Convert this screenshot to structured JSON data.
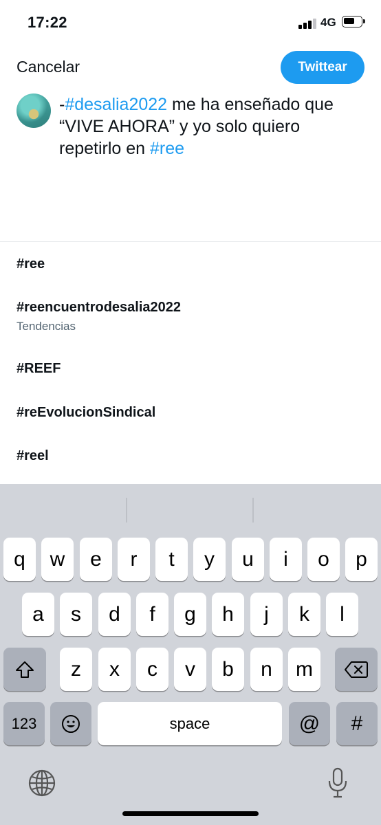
{
  "status_bar": {
    "time": "17:22",
    "network": "4G"
  },
  "compose": {
    "cancel_label": "Cancelar",
    "tweet_label": "Twittear",
    "text": {
      "prefix": "-",
      "hashtag1": "#desalia2022",
      "middle": " me ha enseñado que “VIVE AHORA” y yo solo quiero repetirlo en ",
      "hashtag2": "#ree"
    }
  },
  "suggestions": [
    {
      "label": "#ree",
      "subtitle": ""
    },
    {
      "label": "#reencuentrodesalia2022",
      "subtitle": "Tendencias"
    },
    {
      "label": "#REEF",
      "subtitle": ""
    },
    {
      "label": "#reEvolucionSindical",
      "subtitle": ""
    },
    {
      "label": "#reel",
      "subtitle": ""
    }
  ],
  "keyboard": {
    "row1": [
      "q",
      "w",
      "e",
      "r",
      "t",
      "y",
      "u",
      "i",
      "o",
      "p"
    ],
    "row2": [
      "a",
      "s",
      "d",
      "f",
      "g",
      "h",
      "j",
      "k",
      "l"
    ],
    "row3": [
      "z",
      "x",
      "c",
      "v",
      "b",
      "n",
      "m"
    ],
    "numbers_label": "123",
    "space_label": "space",
    "at_label": "@",
    "hash_label": "#"
  },
  "colors": {
    "accent": "#1d9bf0",
    "text": "#0f1419",
    "secondary": "#536471",
    "keyboard_bg": "#d1d4da"
  }
}
